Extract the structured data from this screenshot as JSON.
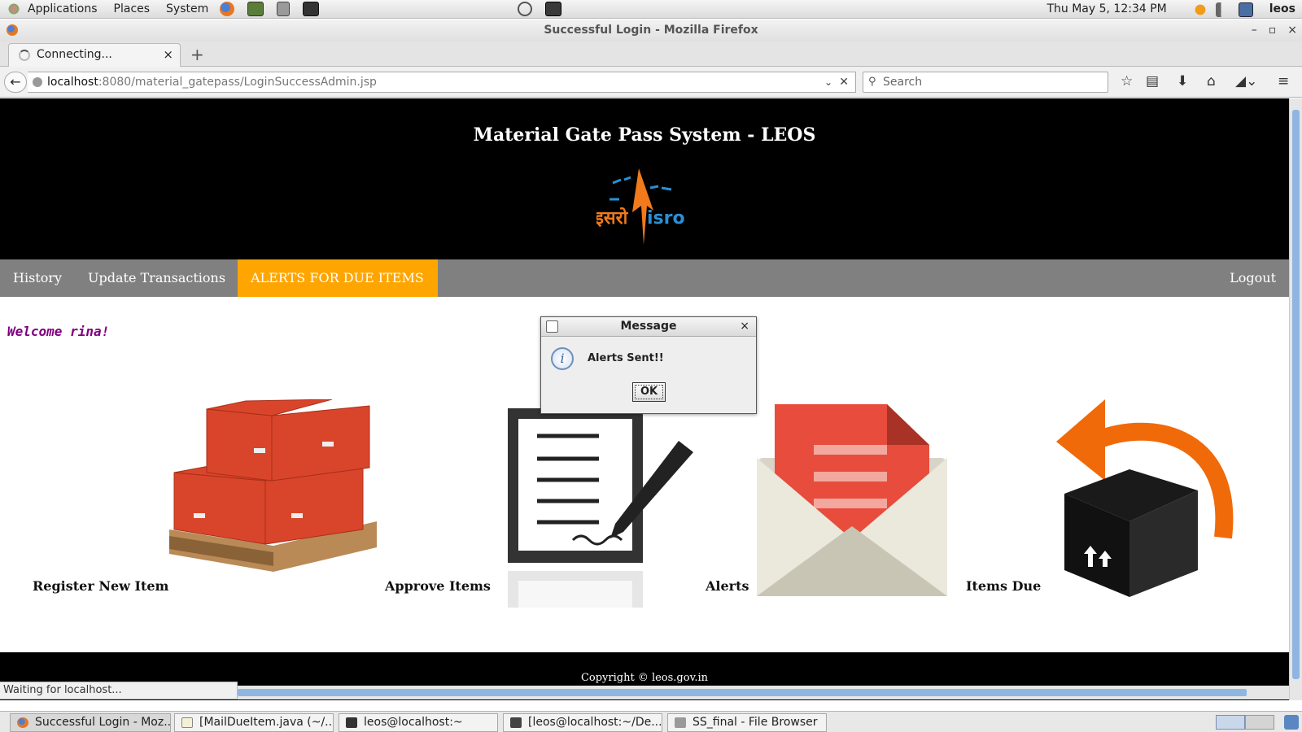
{
  "gnome_panel": {
    "menus": [
      "Applications",
      "Places",
      "System"
    ],
    "clock": "Thu May  5, 12:34 PM",
    "user": "leos"
  },
  "window": {
    "title": "Successful Login - Mozilla Firefox"
  },
  "tab": {
    "title": "Connecting...",
    "close": "×",
    "new_tab": "+"
  },
  "urlbar": {
    "host": "localhost",
    "path": ":8080/material_gatepass/LoginSuccessAdmin.jsp"
  },
  "searchbar": {
    "placeholder": "Search"
  },
  "site": {
    "title": "Material Gate Pass System - LEOS",
    "logo_text_hindi": "इसरो",
    "logo_text": "isro",
    "nav": {
      "history": "History",
      "update_transactions": "Update Transactions",
      "alerts_due": "ALERTS FOR DUE ITEMS",
      "logout": "Logout"
    },
    "welcome": "Welcome rina!",
    "tiles": {
      "register": "Register New Item",
      "approve": "Approve Items",
      "alerts": "Alerts",
      "items_due": "Items Due"
    },
    "footer": "Copyright © leos.gov.in"
  },
  "status_bar": {
    "text": "Waiting for localhost..."
  },
  "dialog": {
    "title": "Message",
    "message": "Alerts Sent!!",
    "ok": "OK",
    "close": "×",
    "icon_glyph": "i"
  },
  "taskbar": {
    "tasks": [
      "Successful Login - Moz...",
      "[MailDueItem.java (~/...",
      "leos@localhost:~",
      "[leos@localhost:~/De...",
      "SS_final - File Browser"
    ]
  },
  "colors": {
    "nav_bg": "#808080",
    "nav_active": "#ffa500",
    "header_bg": "#000000",
    "welcome": "#800080"
  }
}
